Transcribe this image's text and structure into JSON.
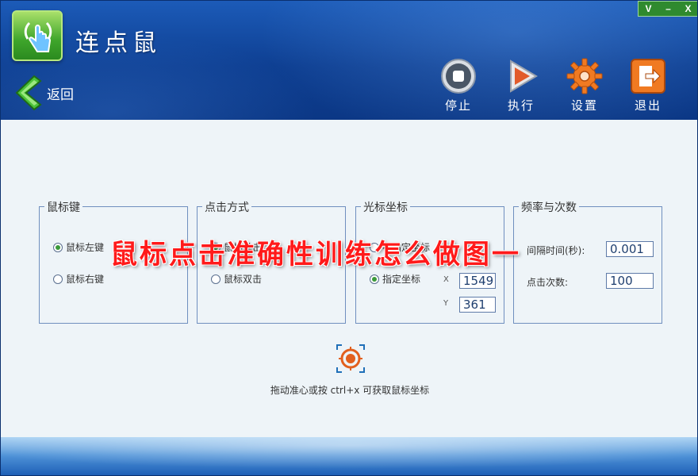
{
  "window": {
    "title": "连点鼠",
    "controls": [
      "V",
      "–",
      "X"
    ]
  },
  "nav": {
    "back_label": "返回"
  },
  "toolbar": {
    "stop_label": "停止",
    "run_label": "执行",
    "settings_label": "设置",
    "exit_label": "退出"
  },
  "mouse_button_group": {
    "title": "鼠标键",
    "options": [
      {
        "label": "鼠标左键",
        "checked": true
      },
      {
        "label": "鼠标右键",
        "checked": false
      }
    ]
  },
  "click_mode_group": {
    "title": "点击方式",
    "options": [
      {
        "label": "鼠标单击",
        "checked": true
      },
      {
        "label": "鼠标双击",
        "checked": false
      }
    ]
  },
  "cursor_group": {
    "title": "光标坐标",
    "options": [
      {
        "label": "不指定坐标",
        "checked": false
      },
      {
        "label": "指定坐标",
        "checked": true
      }
    ],
    "x_label": "X",
    "x_value": "1549",
    "y_label": "Y",
    "y_value": "361"
  },
  "frequency_group": {
    "title": "频率与次数",
    "interval_label": "间隔时间(秒):",
    "interval_value": "0.001",
    "count_label": "点击次数:",
    "count_value": "100"
  },
  "crosshair": {
    "hint": "拖动准心或按 ctrl+x 可获取鼠标坐标"
  },
  "overlay": {
    "caption": "鼠标点击准确性训练怎么做图一"
  },
  "colors": {
    "header": "#0e3f92",
    "body_bg": "#eef4f8",
    "group_border": "#6f8fbf",
    "overlay_text": "#ff1a1a",
    "accent_green": "#3ea52b"
  }
}
